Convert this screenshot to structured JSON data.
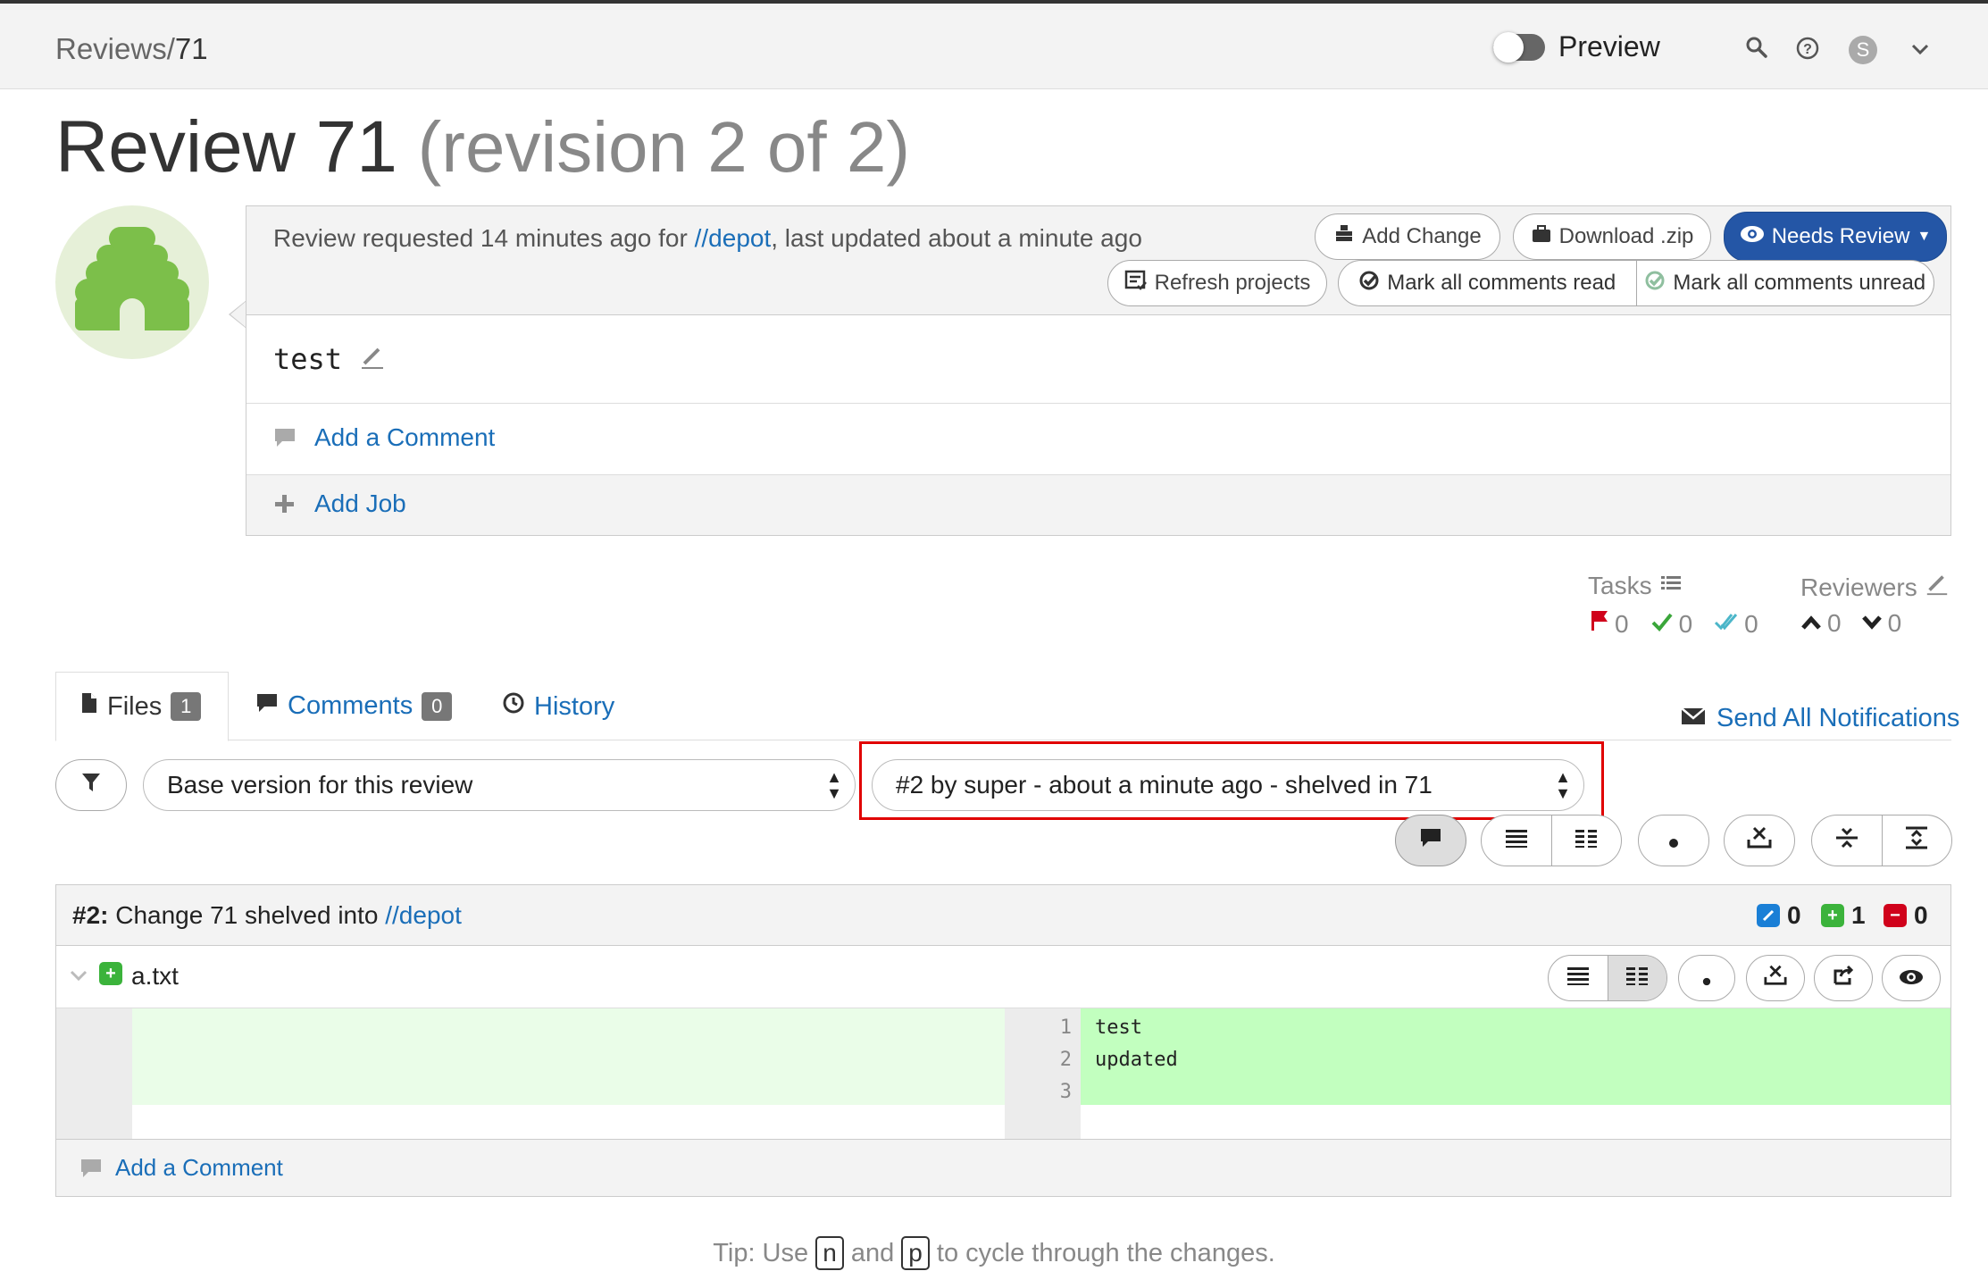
{
  "header": {
    "breadcrumb_root": "Reviews/",
    "breadcrumb_id": "71",
    "preview_label": "Preview",
    "user_initial": "S"
  },
  "title": {
    "main": "Review 71",
    "revision": "(revision 2 of 2)"
  },
  "review": {
    "requested_prefix": "Review requested 14 minutes ago for ",
    "depot_link": "//depot",
    "requested_suffix": ", last updated about a minute ago",
    "description": "test",
    "add_comment": "Add a Comment",
    "add_job": "Add Job"
  },
  "actions": {
    "add_change": "Add Change",
    "download_zip": "Download .zip",
    "needs_review": "Needs Review",
    "refresh_projects": "Refresh projects",
    "mark_read": "Mark all comments read",
    "mark_unread": "Mark all comments unread"
  },
  "tasks": {
    "label": "Tasks",
    "open": "0",
    "addressed": "0",
    "verified": "0"
  },
  "reviewers": {
    "label": "Reviewers",
    "up": "0",
    "down": "0"
  },
  "tabs": [
    {
      "label": "Files",
      "count": "1"
    },
    {
      "label": "Comments",
      "count": "0"
    },
    {
      "label": "History"
    }
  ],
  "send_notifications": "Send All Notifications",
  "version_select": {
    "left": "Base version for this review",
    "right": "#2 by super - about a minute ago - shelved in 71"
  },
  "change": {
    "num": "#2:",
    "text": " Change 71 shelved into ",
    "link": "//depot",
    "edited": "0",
    "added": "1",
    "deleted": "0"
  },
  "file": {
    "name": "a.txt",
    "lines": [
      {
        "n": "1",
        "text": "test"
      },
      {
        "n": "2",
        "text": "updated"
      },
      {
        "n": "3",
        "text": ""
      }
    ],
    "add_comment": "Add a Comment"
  },
  "tip": {
    "prefix": "Tip: Use ",
    "key1": "n",
    "middle": " and ",
    "key2": "p",
    "suffix": " to cycle through the changes."
  },
  "colors": {
    "primary": "#2456a6",
    "link": "#1a6eb8",
    "added_bg": "#c2ffbf",
    "added_light": "#eafde8",
    "highlight_box": "#e00000",
    "avatar_green": "#7cbf4a"
  }
}
